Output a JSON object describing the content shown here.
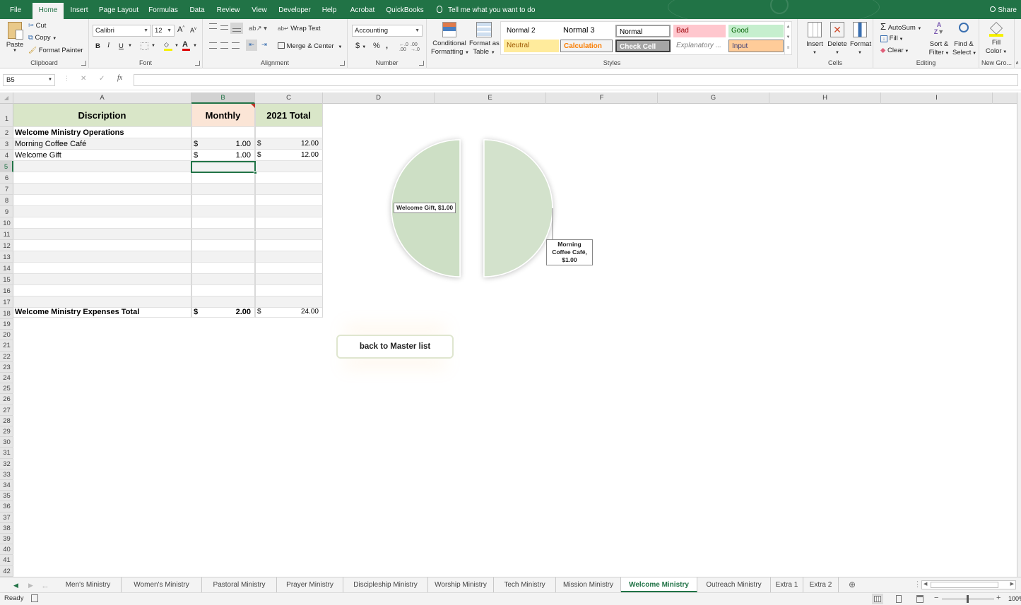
{
  "menubar": {
    "tabs": [
      "File",
      "Home",
      "Insert",
      "Page Layout",
      "Formulas",
      "Data",
      "Review",
      "View",
      "Developer",
      "Help",
      "Acrobat",
      "QuickBooks"
    ],
    "active_tab": "Home",
    "tell_me": "Tell me what you want to do",
    "share": "Share"
  },
  "ribbon": {
    "clipboard": {
      "label": "Clipboard",
      "paste": "Paste",
      "cut": "Cut",
      "copy": "Copy",
      "format_painter": "Format Painter"
    },
    "font": {
      "label": "Font",
      "font_name": "Calibri",
      "font_size": "12",
      "bold": "B",
      "italic": "I",
      "underline": "U"
    },
    "alignment": {
      "label": "Alignment",
      "wrap_text": "Wrap Text",
      "merge_center": "Merge & Center"
    },
    "number": {
      "label": "Number",
      "format": "Accounting",
      "currency": "$",
      "percent": "%",
      "comma": ","
    },
    "styles": {
      "label": "Styles",
      "conditional_formatting": [
        "Conditional",
        "Formatting"
      ],
      "format_as_table": [
        "Format as",
        "Table"
      ],
      "cells": [
        {
          "name": "Normal 2",
          "bg": "#ffffff",
          "fg": "#000000"
        },
        {
          "name": "Normal 3",
          "bg": "#ffffff",
          "fg": "#000000"
        },
        {
          "name": "Normal",
          "bg": "#ffffff",
          "fg": "#000000"
        },
        {
          "name": "Bad",
          "bg": "#ffc7ce",
          "fg": "#9c0006"
        },
        {
          "name": "Good",
          "bg": "#c6efce",
          "fg": "#006100"
        },
        {
          "name": "Neutral",
          "bg": "#ffeb9c",
          "fg": "#9c5700"
        },
        {
          "name": "Calculation",
          "bg": "#f2f2f2",
          "fg": "#fa7d00"
        },
        {
          "name": "Check Cell",
          "bg": "#a5a5a5",
          "fg": "#ffffff"
        },
        {
          "name": "Explanatory ...",
          "bg": "#ffffff",
          "fg": "#7f7f7f"
        },
        {
          "name": "Input",
          "bg": "#ffcc99",
          "fg": "#3f3f76"
        }
      ]
    },
    "cells": {
      "label": "Cells",
      "insert": "Insert",
      "delete": "Delete",
      "format": "Format"
    },
    "editing": {
      "label": "Editing",
      "autosum": "AutoSum",
      "fill": "Fill",
      "clear": "Clear",
      "sort_filter": [
        "Sort &",
        "Filter"
      ],
      "find_select": [
        "Find &",
        "Select"
      ]
    },
    "new_group": {
      "label": "New Gro...",
      "fill_color": [
        "Fill",
        "Color"
      ]
    }
  },
  "formula_bar": {
    "name_box": "B5",
    "formula": "",
    "fx": "fx"
  },
  "columns": [
    "A",
    "B",
    "C",
    "D",
    "E",
    "F",
    "G",
    "H",
    "I"
  ],
  "selected_column": "B",
  "selected_row": 5,
  "sheet": {
    "header": {
      "a": "Discription",
      "b": "Monthly",
      "c": "2021 Total",
      "a_bg": "#d9e6c8",
      "b_bg": "#fbe5d6",
      "c_bg": "#d9e6c8"
    },
    "section_title": "Welcome Ministry Operations",
    "items": [
      {
        "name": "Morning Coffee Café",
        "currency": "$",
        "monthly": "1.00",
        "total_currency": "$",
        "total": "12.00"
      },
      {
        "name": "Welcome Gift",
        "currency": "$",
        "monthly": "1.00",
        "total_currency": "$",
        "total": "12.00"
      }
    ],
    "total_row": {
      "label": "Welcome Ministry Expenses Total",
      "currency": "$",
      "monthly": "2.00",
      "total_currency": "$",
      "total": "24.00"
    }
  },
  "chart_data": {
    "type": "pie",
    "title": "",
    "categories": [
      "Morning Coffee Café",
      "Welcome Gift"
    ],
    "values": [
      1.0,
      1.0
    ],
    "data_labels": [
      "Morning Coffee Café, $1.00",
      "Welcome Gift, $1.00"
    ],
    "colors": [
      "#d3e2cc",
      "#cddfc5"
    ],
    "exploded": true,
    "legend": "none"
  },
  "back_button": {
    "label": "back to Master list"
  },
  "sheet_tabs": {
    "more": "...",
    "tabs": [
      "Men's Ministry",
      "Women's Ministry",
      "Pastoral Ministry",
      "Prayer Ministry",
      "Discipleship Ministry",
      "Worship Ministry",
      "Tech Ministry",
      "Mission Ministry",
      "Welcome Ministry",
      "Outreach Ministry",
      "Extra 1",
      "Extra 2"
    ],
    "active": "Welcome Ministry"
  },
  "status_bar": {
    "status": "Ready",
    "zoom": "100%"
  }
}
